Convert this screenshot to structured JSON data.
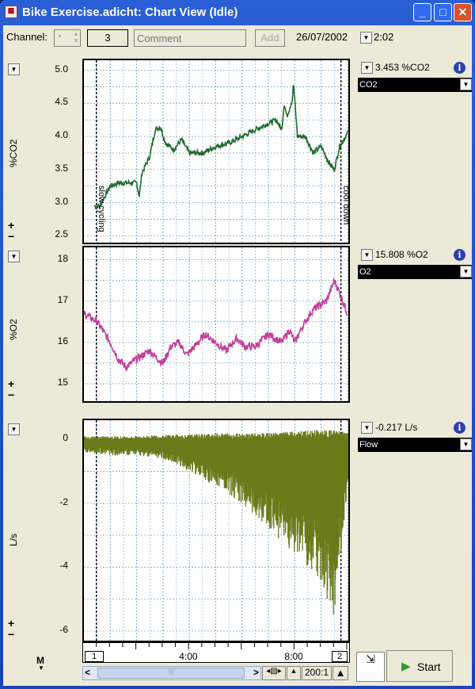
{
  "window": {
    "title": "Bike Exercise.adicht: Chart View (Idle)",
    "minimize": "_",
    "maximize": "□",
    "close": "✕"
  },
  "toolbar": {
    "channel_label": "Channel:",
    "channel_value": "*",
    "comment_number": "3",
    "comment_placeholder": "Comment",
    "add_label": "Add",
    "date": "26/07/2002",
    "time": "2:02"
  },
  "comments": [
    {
      "label": "slow cycling",
      "time_min": 0.47
    },
    {
      "label": "cool down",
      "time_min": 9.75
    }
  ],
  "colors": {
    "co2": "#1f6b2e",
    "o2": "#c0409a",
    "flow": "#6b7a1a",
    "grid": "#7fa9c9"
  },
  "channels": [
    {
      "name": "CO2",
      "unit_label": "%CO2",
      "readout": "3.453 %CO2",
      "ticks": [
        "5.0",
        "4.5",
        "4.0",
        "3.5",
        "3.0",
        "2.5"
      ],
      "tick_values": [
        5.0,
        4.5,
        4.0,
        3.5,
        3.0,
        2.5
      ],
      "ylim": [
        2.35,
        5.15
      ]
    },
    {
      "name": "O2",
      "unit_label": "%O2",
      "readout": "15.808 %O2",
      "ticks": [
        "18",
        "17",
        "16",
        "15"
      ],
      "tick_values": [
        18,
        17,
        16,
        15
      ],
      "ylim": [
        14.5,
        18.3
      ]
    },
    {
      "name": "Flow",
      "unit_label": "L/s",
      "readout": "-0.217 L/s",
      "ticks": [
        "0",
        "-2",
        "-4",
        "-6"
      ],
      "tick_values": [
        0,
        -2,
        -4,
        -6
      ],
      "ylim": [
        -6.4,
        0.6
      ]
    }
  ],
  "chart_data": [
    {
      "type": "line",
      "channel": "CO2",
      "x_min": [
        0.4,
        0.6,
        1.0,
        1.3,
        1.6,
        2.0,
        2.1,
        2.2,
        2.5,
        2.7,
        2.9,
        3.1,
        3.4,
        3.7,
        4.0,
        4.5,
        5.0,
        5.5,
        6.0,
        6.5,
        7.0,
        7.3,
        7.5,
        7.6,
        7.7,
        7.9,
        7.95,
        8.1,
        8.4,
        8.7,
        9.0,
        9.3,
        9.5,
        9.7,
        10.0
      ],
      "y": [
        2.95,
        2.95,
        3.25,
        3.3,
        3.3,
        3.3,
        3.1,
        3.45,
        3.7,
        4.1,
        4.15,
        3.9,
        3.8,
        3.95,
        3.75,
        3.75,
        3.85,
        3.9,
        4.0,
        4.1,
        4.2,
        4.25,
        4.1,
        4.5,
        4.3,
        4.55,
        4.8,
        4.0,
        4.0,
        3.75,
        3.85,
        3.6,
        3.5,
        3.85,
        4.05
      ]
    },
    {
      "type": "line",
      "channel": "O2",
      "x_min": [
        0,
        0.5,
        1.0,
        1.3,
        1.6,
        2.0,
        2.5,
        2.8,
        3.0,
        3.3,
        3.6,
        3.9,
        4.2,
        4.6,
        5.0,
        5.4,
        5.8,
        6.1,
        6.5,
        7.0,
        7.5,
        7.8,
        8.0,
        8.3,
        8.7,
        9.2,
        9.5,
        9.7,
        10.0
      ],
      "y": [
        16.7,
        16.5,
        16.0,
        15.6,
        15.4,
        15.6,
        15.8,
        15.6,
        15.5,
        15.9,
        16.0,
        15.7,
        15.9,
        16.2,
        16.0,
        15.8,
        16.1,
        15.9,
        15.9,
        16.2,
        16.0,
        16.3,
        16.0,
        16.4,
        16.8,
        17.0,
        17.5,
        17.2,
        16.7
      ]
    },
    {
      "type": "area",
      "channel": "Flow",
      "x_min": [
        0,
        1,
        2,
        3,
        4,
        5,
        6,
        7,
        8,
        9,
        9.5,
        9.7,
        10.0
      ],
      "y_min": [
        -0.4,
        -0.5,
        -0.5,
        -0.6,
        -1.0,
        -1.5,
        -2.0,
        -2.8,
        -3.6,
        -4.5,
        -5.7,
        -4.0,
        -2.0
      ],
      "y_max": [
        0.1,
        0.1,
        0.1,
        0.15,
        0.15,
        0.2,
        0.2,
        0.2,
        0.25,
        0.3,
        0.3,
        0.3,
        0.2
      ]
    }
  ],
  "time_axis": {
    "xlim_min": [
      0,
      10.03
    ],
    "ticks": [
      "4:00",
      "8:00"
    ],
    "tick_values": [
      4,
      8
    ],
    "left_marker": "1",
    "right_marker": "2"
  },
  "bottom": {
    "marker": "M",
    "zoom_ratio": "200:1",
    "start_label": "Start"
  }
}
